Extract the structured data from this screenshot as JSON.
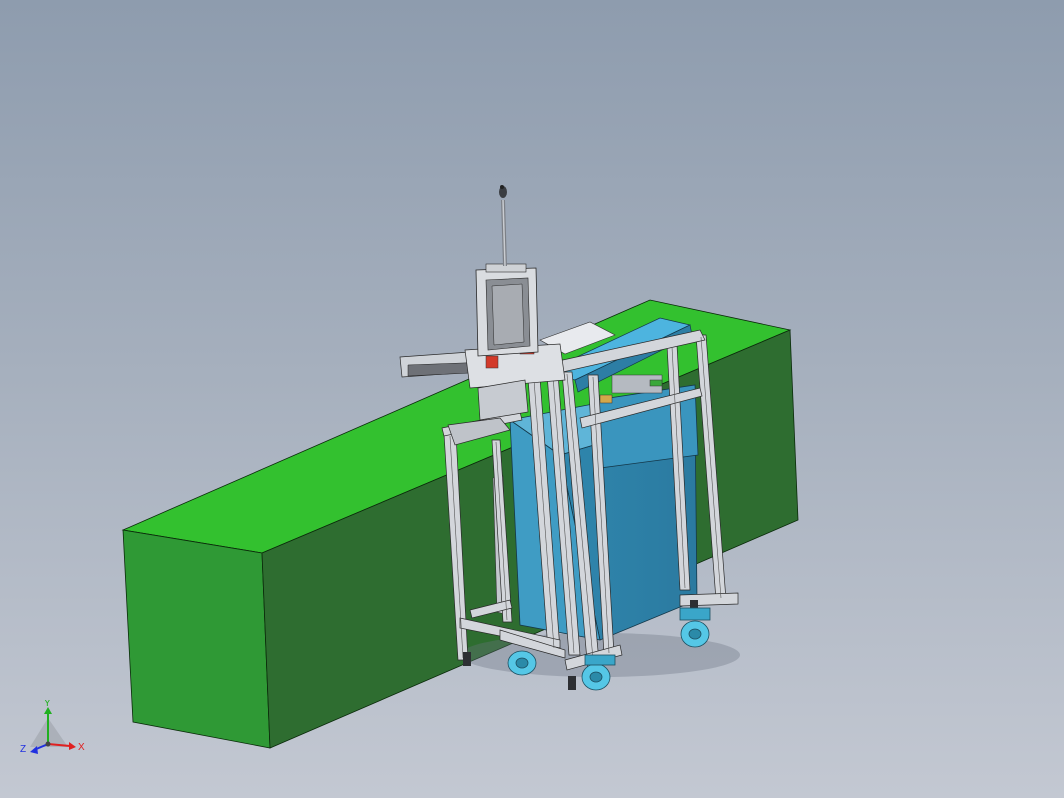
{
  "viewport": {
    "background_top": "#8e9cae",
    "background_bottom": "#c3c8d2"
  },
  "model": {
    "base_block_color": "#2f9f34",
    "machine_body_color": "#3f8fb5",
    "frame_color": "#c9ccd2",
    "wheel_color": "#55c7e6"
  },
  "triad": {
    "x_label": "X",
    "y_label": "Y",
    "z_label": "Z",
    "x_color": "#e02020",
    "y_color": "#20b020",
    "z_color": "#2030e0"
  }
}
